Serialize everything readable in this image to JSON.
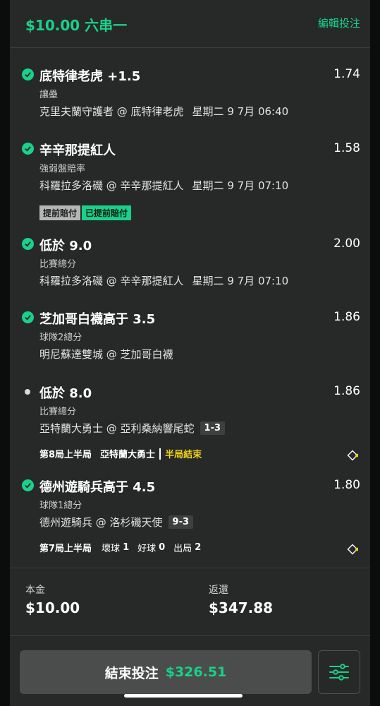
{
  "header": {
    "title": "$10.00 六串一",
    "edit_label": "編輯投注"
  },
  "legs": [
    {
      "status": "won",
      "selection": "底特律老虎 +1.5",
      "odds": "1.74",
      "market": "讓壘",
      "event": "克里夫蘭守護者 @ 底特律老虎",
      "time": "星期二 9 7月 06:40"
    },
    {
      "status": "won",
      "selection": "辛辛那提紅人",
      "odds": "1.58",
      "market": "強弱盤賠率",
      "event": "科羅拉多洛磯 @ 辛辛那提紅人",
      "time": "星期二 9 7月 07:10",
      "badges": [
        "提前賠付",
        "已提前賠付"
      ]
    },
    {
      "status": "won",
      "selection": "低於 9.0",
      "odds": "2.00",
      "market": "比賽總分",
      "event": "科羅拉多洛磯 @ 辛辛那提紅人",
      "time": "星期二 9 7月 07:10"
    },
    {
      "status": "won",
      "selection": "芝加哥白襪高于 3.5",
      "odds": "1.86",
      "market": "球隊2總分",
      "event": "明尼蘇達雙城 @ 芝加哥白襪"
    },
    {
      "status": "open",
      "selection": "低於 8.0",
      "odds": "1.86",
      "market": "比賽總分",
      "event": "亞特蘭大勇士 @ 亞利桑納響尾蛇",
      "score": "1-3",
      "live": {
        "inning": "第8局上半局",
        "team": "亞特蘭大勇士",
        "state": "半局結束"
      }
    },
    {
      "status": "won",
      "selection": "德州遊騎兵高于 4.5",
      "odds": "1.80",
      "market": "球隊1總分",
      "event": "德州遊騎兵 @ 洛杉磯天使",
      "score": "9-3",
      "live": {
        "inning": "第7局上半局",
        "balls_label": "壞球",
        "balls": "1",
        "strikes_label": "好球",
        "strikes": "0",
        "outs_label": "出局",
        "outs": "2"
      }
    }
  ],
  "summary": {
    "stake_label": "本金",
    "stake_value": "$10.00",
    "return_label": "返還",
    "return_value": "$347.88"
  },
  "cashout": {
    "label": "結束投注",
    "amount": "$326.51"
  },
  "colors": {
    "accent": "#19d18a",
    "panel": "#262928",
    "live_yellow": "#f2d218"
  },
  "icons": {
    "check": "check-circle-icon",
    "settings": "sliders-icon",
    "diamond": "baseball-diamond-icon"
  }
}
